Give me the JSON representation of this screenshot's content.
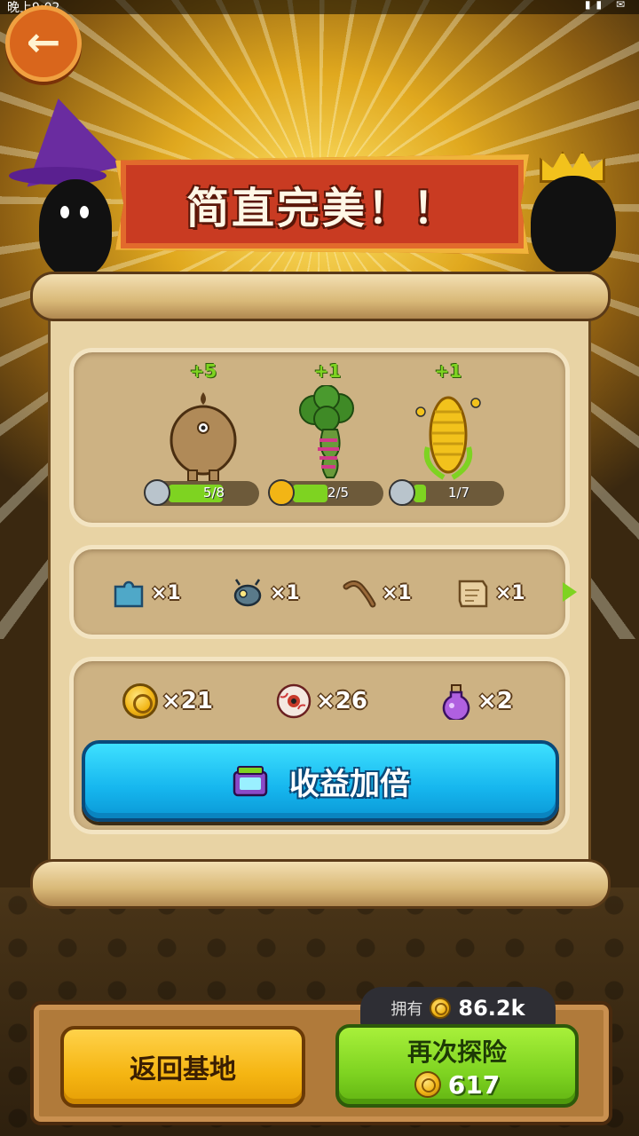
{
  "status_bar": {
    "time": "晚上9:02",
    "icons": "▮▮ ✉"
  },
  "banner": {
    "title": "简直完美！！"
  },
  "plants": [
    {
      "name": "mandrake",
      "bonus": "+5",
      "progress_text": "5/8",
      "progress": 0.625,
      "rank": "silver"
    },
    {
      "name": "broccoli",
      "bonus": "+1",
      "progress_text": "2/5",
      "progress": 0.4,
      "rank": "gold"
    },
    {
      "name": "corn",
      "bonus": "+1",
      "progress_text": "1/7",
      "progress": 0.143,
      "rank": "silver"
    }
  ],
  "items": [
    {
      "icon": "puzzle-piece-icon",
      "count": "×1"
    },
    {
      "icon": "mechanical-bug-icon",
      "count": "×1"
    },
    {
      "icon": "worm-icon",
      "count": "×1"
    },
    {
      "icon": "scroll-map-icon",
      "count": "×1"
    }
  ],
  "resources": [
    {
      "icon": "coin-icon",
      "count": "×21"
    },
    {
      "icon": "eyeball-icon",
      "count": "×26"
    },
    {
      "icon": "potion-icon",
      "count": "×2"
    }
  ],
  "double_button": {
    "label": "收益加倍"
  },
  "owned": {
    "label": "拥有",
    "value": "86.2k"
  },
  "return_button": {
    "label": "返回基地"
  },
  "again_button": {
    "label": "再次探险",
    "cost": "617"
  },
  "colors": {
    "accent_green": "#7ed321",
    "double_blue": "#16b6ee",
    "banner_red": "#c93b22"
  }
}
